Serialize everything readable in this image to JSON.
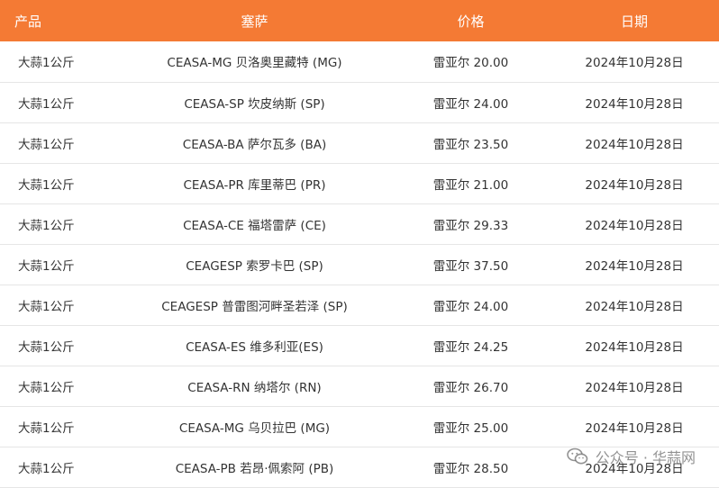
{
  "table": {
    "headers": {
      "product": "产品",
      "market": "塞萨",
      "price": "价格",
      "date": "日期"
    },
    "rows": [
      {
        "product": "大蒜1公斤",
        "market": "CEASA-MG 贝洛奥里藏特 (MG)",
        "price": "雷亚尔 20.00",
        "date": "2024年10月28日"
      },
      {
        "product": "大蒜1公斤",
        "market": "CEASA-SP 坎皮纳斯 (SP)",
        "price": "雷亚尔 24.00",
        "date": "2024年10月28日"
      },
      {
        "product": "大蒜1公斤",
        "market": "CEASA-BA 萨尔瓦多 (BA)",
        "price": "雷亚尔 23.50",
        "date": "2024年10月28日"
      },
      {
        "product": "大蒜1公斤",
        "market": "CEASA-PR 库里蒂巴 (PR)",
        "price": "雷亚尔 21.00",
        "date": "2024年10月28日"
      },
      {
        "product": "大蒜1公斤",
        "market": "CEASA-CE 福塔雷萨 (CE)",
        "price": "雷亚尔 29.33",
        "date": "2024年10月28日"
      },
      {
        "product": "大蒜1公斤",
        "market": "CEAGESP 索罗卡巴 (SP)",
        "price": "雷亚尔 37.50",
        "date": "2024年10月28日"
      },
      {
        "product": "大蒜1公斤",
        "market": "CEAGESP 普雷图河畔圣若泽 (SP)",
        "price": "雷亚尔 24.00",
        "date": "2024年10月28日"
      },
      {
        "product": "大蒜1公斤",
        "market": "CEASA-ES 维多利亚(ES)",
        "price": "雷亚尔 24.25",
        "date": "2024年10月28日"
      },
      {
        "product": "大蒜1公斤",
        "market": "CEASA-RN 纳塔尔 (RN)",
        "price": "雷亚尔 26.70",
        "date": "2024年10月28日"
      },
      {
        "product": "大蒜1公斤",
        "market": "CEASA-MG 乌贝拉巴 (MG)",
        "price": "雷亚尔 25.00",
        "date": "2024年10月28日"
      },
      {
        "product": "大蒜1公斤",
        "market": "CEASA-PB 若昂·佩索阿 (PB)",
        "price": "雷亚尔 28.50",
        "date": "2024年10月28日"
      }
    ]
  },
  "watermark": {
    "text": "公众号 · 华蒜网",
    "icon": "wechat-icon"
  },
  "colors": {
    "header_bg": "#f47a34",
    "header_text": "#ffffff",
    "row_border": "#e6e6e6"
  }
}
